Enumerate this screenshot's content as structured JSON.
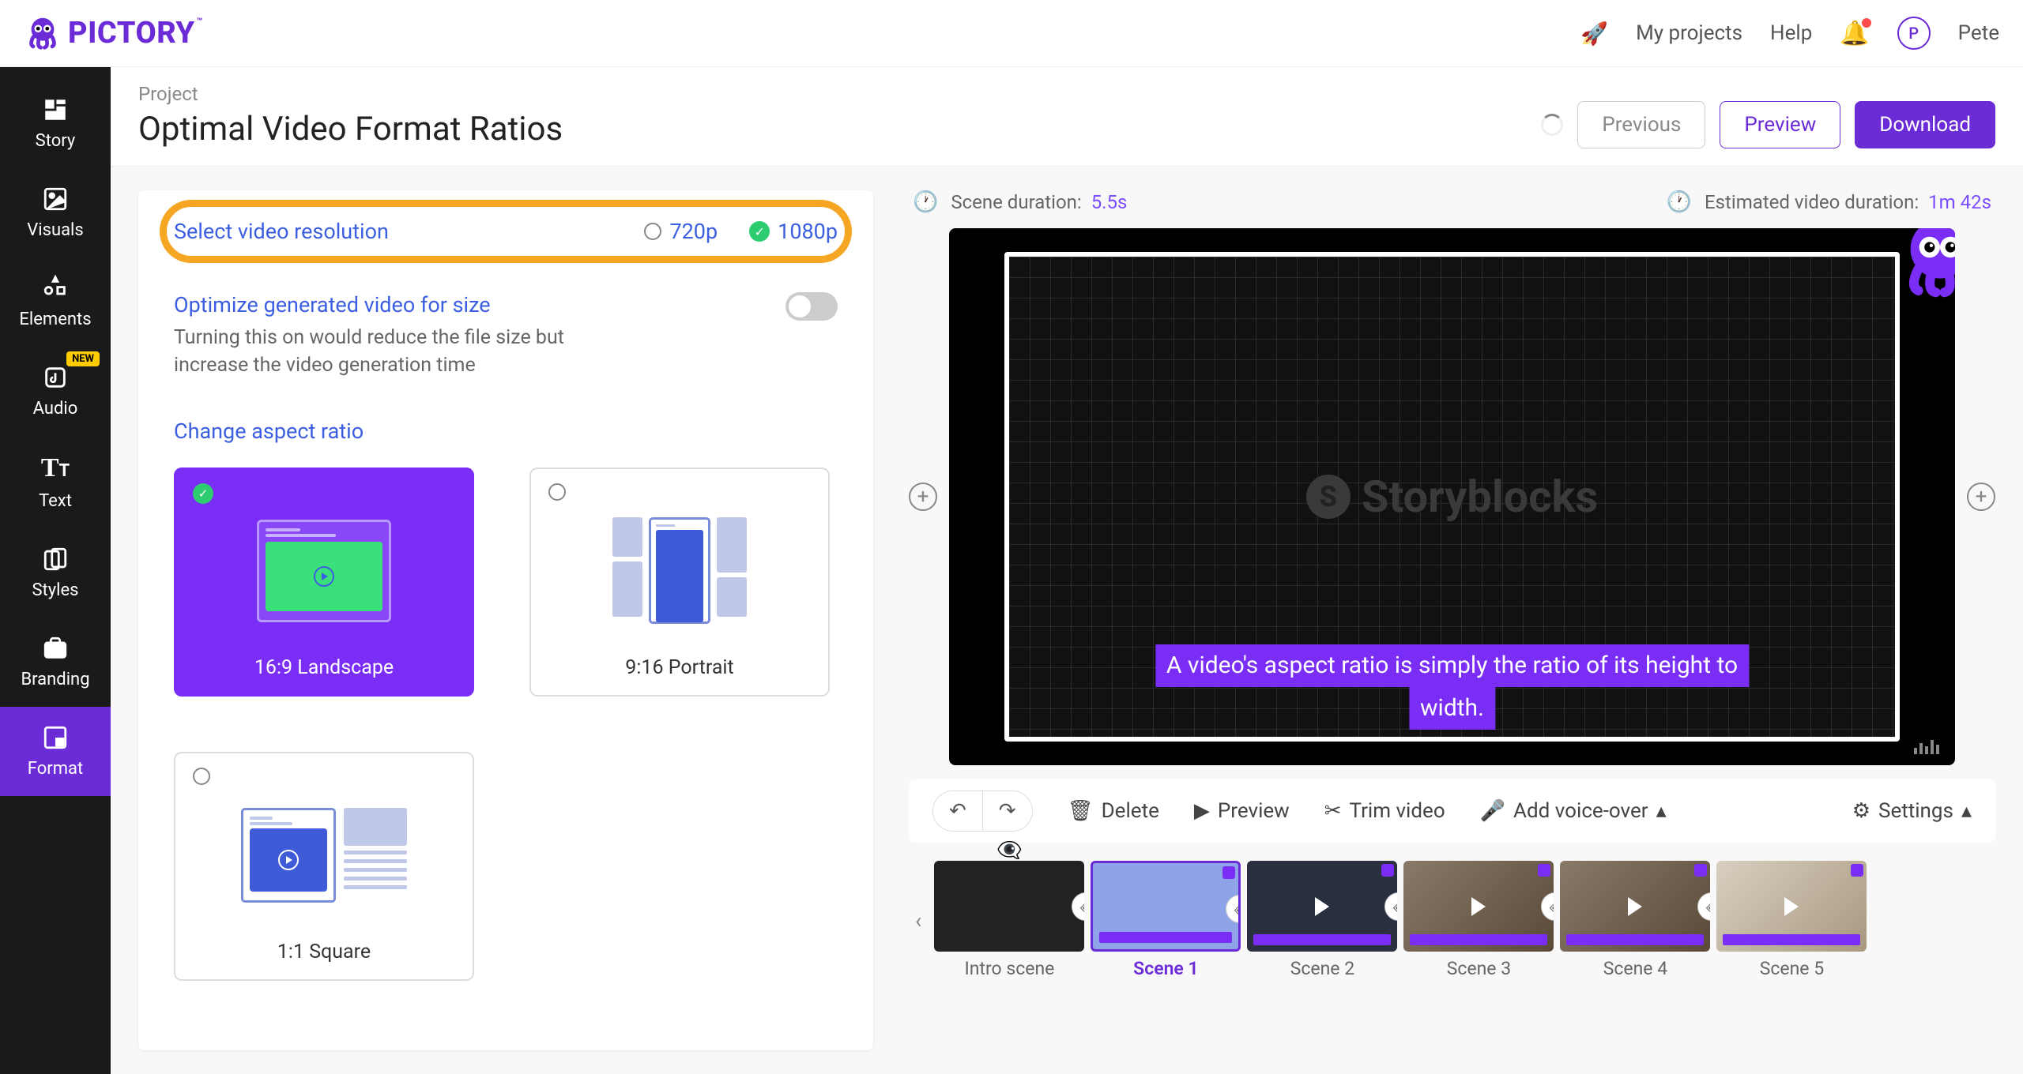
{
  "brand": {
    "name": "PICTORY",
    "tm": "™"
  },
  "topbar": {
    "my_projects": "My projects",
    "help": "Help",
    "user_initial": "P",
    "username": "Pete"
  },
  "sidebar": {
    "items": [
      {
        "label": "Story",
        "icon": "⬛"
      },
      {
        "label": "Visuals",
        "icon": "🖼"
      },
      {
        "label": "Elements",
        "icon": "◇"
      },
      {
        "label": "Audio",
        "icon": "♫",
        "badge": "NEW"
      },
      {
        "label": "Text",
        "icon": "Tᴛ"
      },
      {
        "label": "Styles",
        "icon": "▧"
      },
      {
        "label": "Branding",
        "icon": "💼"
      },
      {
        "label": "Format",
        "icon": "◲",
        "active": true
      }
    ]
  },
  "project": {
    "label": "Project",
    "title": "Optimal Video Format Ratios"
  },
  "buttons": {
    "previous": "Previous",
    "preview": "Preview",
    "download": "Download"
  },
  "format": {
    "resolution_title": "Select video resolution",
    "res_720": "720p",
    "res_1080": "1080p",
    "optimize_title": "Optimize generated video for size",
    "optimize_desc": "Turning this on would reduce the file size but increase the video generation time",
    "aspect_title": "Change aspect ratio",
    "aspects": [
      {
        "label": "16:9 Landscape",
        "active": true
      },
      {
        "label": "9:16 Portrait"
      },
      {
        "label": "1:1 Square"
      }
    ]
  },
  "preview": {
    "scene_duration_label": "Scene duration:",
    "scene_duration_value": "5.5s",
    "est_duration_label": "Estimated video duration:",
    "est_duration_value": "1m 42s",
    "watermark": "Storyblocks",
    "caption_line1": "A video's aspect ratio is simply the ratio of its height to",
    "caption_line2": "width."
  },
  "toolbar": {
    "delete": "Delete",
    "preview": "Preview",
    "trim": "Trim video",
    "voiceover": "Add voice-over",
    "settings": "Settings"
  },
  "scenes": [
    {
      "label": "Intro scene"
    },
    {
      "label": "Scene 1",
      "active": true
    },
    {
      "label": "Scene 2"
    },
    {
      "label": "Scene 3"
    },
    {
      "label": "Scene 4"
    },
    {
      "label": "Scene 5"
    }
  ]
}
